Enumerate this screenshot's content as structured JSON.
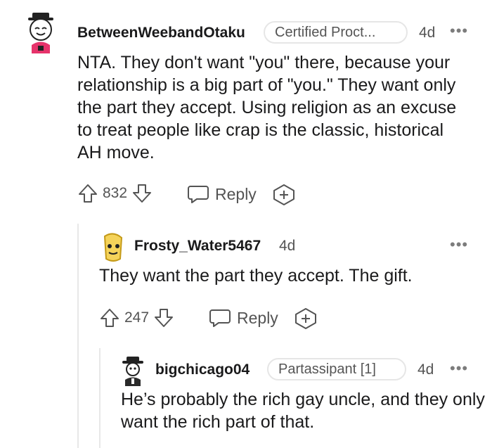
{
  "comments": [
    {
      "username": "BetweenWeebandOtaku",
      "flair": "Certified Proct...",
      "time": "4d",
      "more": "•••",
      "body": "NTA. They don't want \"you\" there, because your relationship is a big part of \"you.\" They want only the part they accept. Using religion as an excuse to treat people like crap is the classic, historical AH move.",
      "votes": "832",
      "reply_label": "Reply"
    },
    {
      "username": "Frosty_Water5467",
      "time": "4d",
      "more": "•••",
      "body": "They want the part they accept. The gift.",
      "votes": "247",
      "reply_label": "Reply"
    },
    {
      "username": "bigchicago04",
      "flair": "Partassipant [1]",
      "time": "4d",
      "more": "•••",
      "body": "He’s probably the rich gay uncle, and they only want the rich part of that."
    }
  ],
  "colors": {
    "text": "#1a1a1b",
    "muted": "#545454",
    "flair_border": "#e6e6e6",
    "thread_line": "#e8e8e8"
  }
}
